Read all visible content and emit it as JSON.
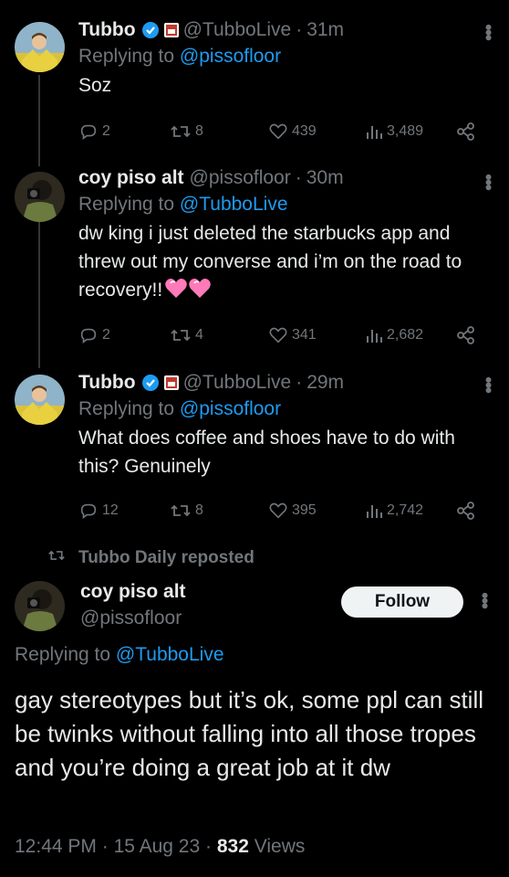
{
  "tweets": [
    {
      "name": "Tubbo",
      "handle": "@TubboLive",
      "time": "31m",
      "reply_prefix": "Replying to ",
      "reply_to": "@pissofloor",
      "text": "Soz",
      "replies": "2",
      "reposts": "8",
      "likes": "439",
      "views": "3,489"
    },
    {
      "name": "coy piso alt",
      "handle": "@pissofloor",
      "time": "30m",
      "reply_prefix": "Replying to ",
      "reply_to": "@TubboLive",
      "text": "dw king i just deleted the starbucks app and threw out my converse and i’m on the road to recovery!!",
      "replies": "2",
      "reposts": "4",
      "likes": "341",
      "views": "2,682"
    },
    {
      "name": "Tubbo",
      "handle": "@TubboLive",
      "time": "29m",
      "reply_prefix": "Replying to ",
      "reply_to": "@pissofloor",
      "text": "What does coffee and shoes have to do with this? Genuinely",
      "replies": "12",
      "reposts": "8",
      "likes": "395",
      "views": "2,742"
    }
  ],
  "repost_banner": "Tubbo Daily reposted",
  "main_tweet": {
    "name": "coy piso alt",
    "handle": "@pissofloor",
    "follow_label": "Follow",
    "reply_prefix": "Replying to ",
    "reply_to": "@TubboLive",
    "text": "gay stereotypes but it’s ok, some ppl can still be twinks without falling into all those tropes and you’re doing a great job at it dw",
    "time": "12:44 PM",
    "date": "15 Aug 23",
    "views_count": "832",
    "views_label": "Views"
  },
  "separator": "·",
  "colors": {
    "background": "#000000",
    "text": "#e7e9ea",
    "secondary": "#71767b",
    "link": "#1d9bf0",
    "verified": "#1d9bf0"
  }
}
